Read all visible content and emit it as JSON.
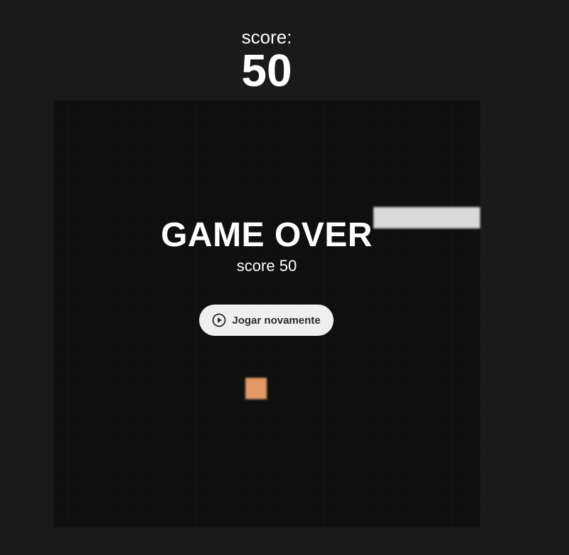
{
  "header": {
    "score_label": "score:",
    "score_value": "50"
  },
  "overlay": {
    "title": "GAME OVER",
    "score_text": "score 50"
  },
  "replay_button": {
    "label": "Jogar novamente",
    "icon": "play-circle-icon"
  },
  "colors": {
    "background": "#1a1a1a",
    "board": "#0f0f0f",
    "snake": "#d9d9d9",
    "food": "#e39a66",
    "button": "#efefef"
  }
}
